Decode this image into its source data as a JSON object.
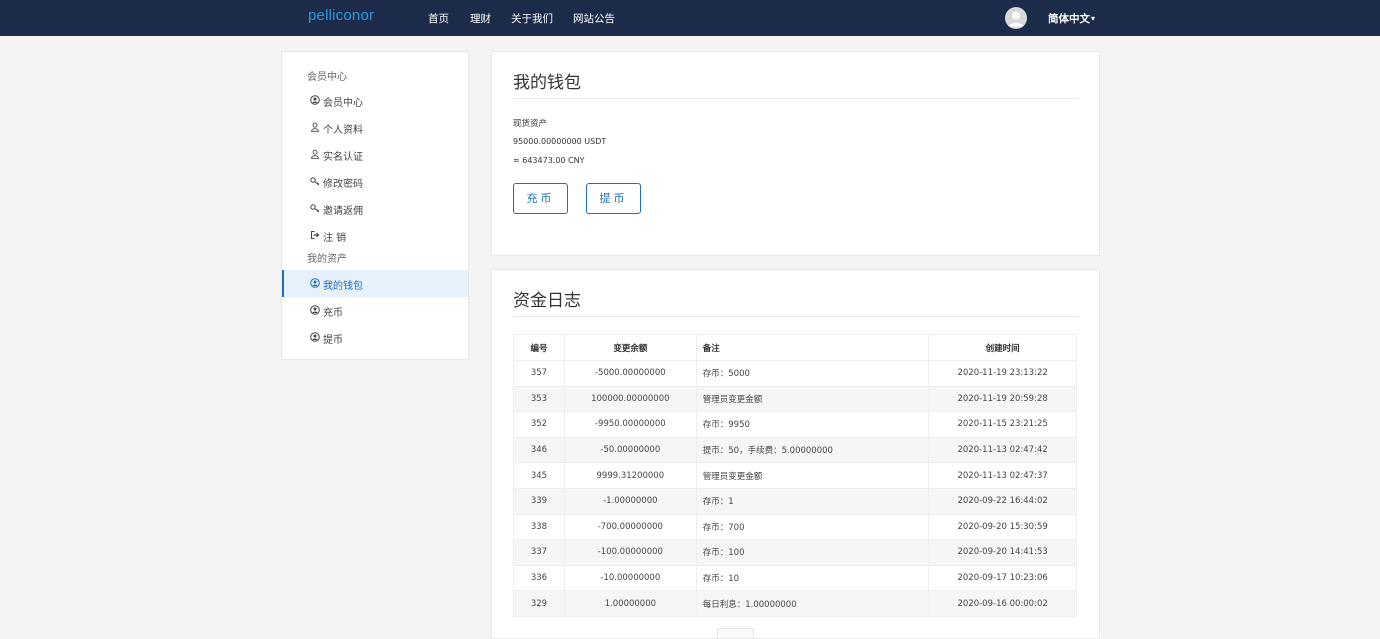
{
  "header": {
    "brand": "pelliconor",
    "nav": [
      {
        "label": "首页"
      },
      {
        "label": "理财"
      },
      {
        "label": "关于我们"
      },
      {
        "label": "网站公告"
      }
    ],
    "language": "简体中文",
    "language_caret": "▾"
  },
  "sidebar": {
    "group_member": "会员中心",
    "member_items": [
      {
        "label": "会员中心",
        "icon": "user-circle-icon"
      },
      {
        "label": "个人资料",
        "icon": "user-icon"
      },
      {
        "label": "实名认证",
        "icon": "user-icon"
      },
      {
        "label": "修改密码",
        "icon": "key-icon"
      },
      {
        "label": "邀请返佣",
        "icon": "key-icon"
      },
      {
        "label": "注 销",
        "icon": "logout-icon"
      }
    ],
    "group_assets": "我的资产",
    "asset_items": [
      {
        "label": "我的钱包",
        "icon": "user-circle-icon",
        "active": true
      },
      {
        "label": "充币",
        "icon": "user-circle-icon"
      },
      {
        "label": "提币",
        "icon": "user-circle-icon"
      }
    ]
  },
  "wallet": {
    "title": "我的钱包",
    "spot_label": "现货资产",
    "usdt_value": "95000.00000000 USDT",
    "cny_value": "≈ 643473.00 CNY",
    "deposit_button": "充币",
    "withdraw_button": "提币"
  },
  "log": {
    "title": "资金日志",
    "columns": [
      "编号",
      "变更余额",
      "备注",
      "创建时间"
    ],
    "rows": [
      {
        "id": "357",
        "amount": "-5000.00000000",
        "note": "存币：5000",
        "time": "2020-11-19 23:13:22"
      },
      {
        "id": "353",
        "amount": "100000.00000000",
        "note": "管理员变更金额",
        "time": "2020-11-19 20:59:28"
      },
      {
        "id": "352",
        "amount": "-9950.00000000",
        "note": "存币：9950",
        "time": "2020-11-15 23:21:25"
      },
      {
        "id": "346",
        "amount": "-50.00000000",
        "note": "提币：50，手续费：5.00000000",
        "time": "2020-11-13 02:47:42"
      },
      {
        "id": "345",
        "amount": "9999.31200000",
        "note": "管理员变更金额",
        "time": "2020-11-13 02:47:37"
      },
      {
        "id": "339",
        "amount": "-1.00000000",
        "note": "存币：1",
        "time": "2020-09-22 16:44:02"
      },
      {
        "id": "338",
        "amount": "-700.00000000",
        "note": "存币：700",
        "time": "2020-09-20 15:30:59"
      },
      {
        "id": "337",
        "amount": "-100.00000000",
        "note": "存币：100",
        "time": "2020-09-20 14:41:53"
      },
      {
        "id": "336",
        "amount": "-10.00000000",
        "note": "存币：10",
        "time": "2020-09-17 10:23:06"
      },
      {
        "id": "329",
        "amount": "1.00000000",
        "note": "每日利息：1.00000000",
        "time": "2020-09-16 00:00:02"
      }
    ]
  },
  "colors": {
    "header_bg": "#1c2b4a",
    "brand": "#2b9ae8",
    "accent": "#1e6fb8",
    "active_bg": "#e6f1fb"
  }
}
